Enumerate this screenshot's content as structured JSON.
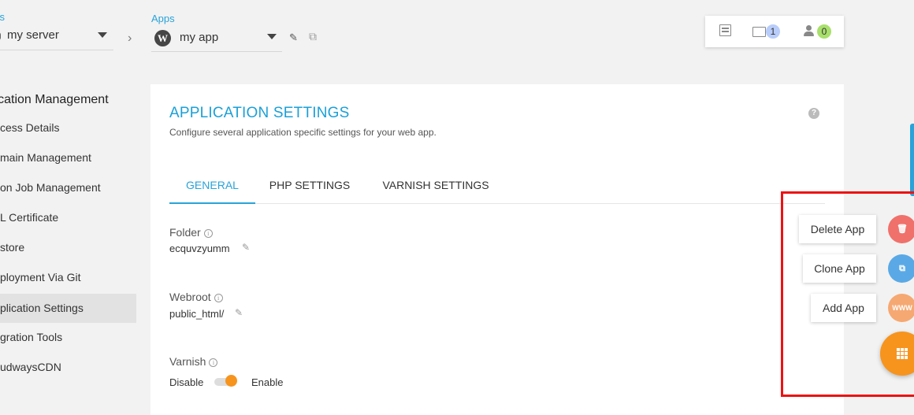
{
  "topbar": {
    "servers_label": "ers",
    "server_value": "my server",
    "apps_label": "Apps",
    "app_value": "my app",
    "folder_count": "1",
    "user_count": "0"
  },
  "nav": {
    "title": "lication Management",
    "items": [
      {
        "label": "cess Details"
      },
      {
        "label": "main Management"
      },
      {
        "label": "on Job Management"
      },
      {
        "label": "L Certificate"
      },
      {
        "label": "store"
      },
      {
        "label": "ployment Via Git"
      },
      {
        "label": "plication Settings"
      },
      {
        "label": "gration Tools"
      },
      {
        "label": "udwaysCDN"
      }
    ],
    "active_index": 6
  },
  "panel": {
    "title": "APPLICATION SETTINGS",
    "subtitle": "Configure several application specific settings for your web app.",
    "tabs": [
      {
        "label": "GENERAL"
      },
      {
        "label": "PHP SETTINGS"
      },
      {
        "label": "VARNISH SETTINGS"
      }
    ],
    "active_tab": 0,
    "fields": {
      "folder_label": "Folder",
      "folder_value": "ecquvzyumm",
      "webroot_label": "Webroot",
      "webroot_value": "public_html/",
      "varnish_label": "Varnish",
      "varnish_off": "Disable",
      "varnish_on": "Enable"
    }
  },
  "fab": {
    "delete_label": "Delete App",
    "clone_label": "Clone App",
    "add_label": "Add App",
    "www_text": "WWW"
  },
  "colors": {
    "accent": "#29a3d9",
    "orange": "#f7941d",
    "delete": "#f0716b",
    "clone": "#5aa9e6",
    "add": "#f6a872",
    "highlight": "#ee1111"
  }
}
